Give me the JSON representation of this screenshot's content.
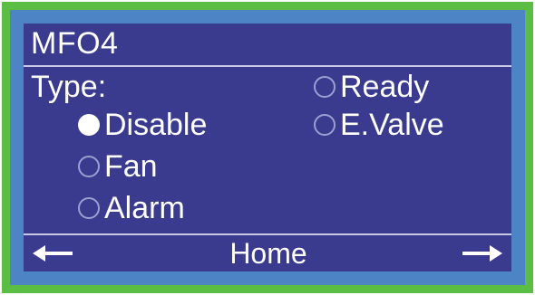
{
  "screen": {
    "title": "MFO4",
    "type_label": "Type:"
  },
  "options": {
    "disable": {
      "label": "Disable",
      "selected": true
    },
    "fan": {
      "label": "Fan",
      "selected": false
    },
    "alarm": {
      "label": "Alarm",
      "selected": false
    },
    "ready": {
      "label": "Ready",
      "selected": false
    },
    "evalve": {
      "label": "E.Valve",
      "selected": false
    }
  },
  "footer": {
    "left_icon": "arrow-left-icon",
    "home_label": "Home",
    "right_icon": "arrow-right-icon"
  },
  "colors": {
    "outer_frame": "#5cbd45",
    "bezel": "#4d84c6",
    "screen_bg": "#3a3a8f",
    "text": "#ffffff"
  }
}
